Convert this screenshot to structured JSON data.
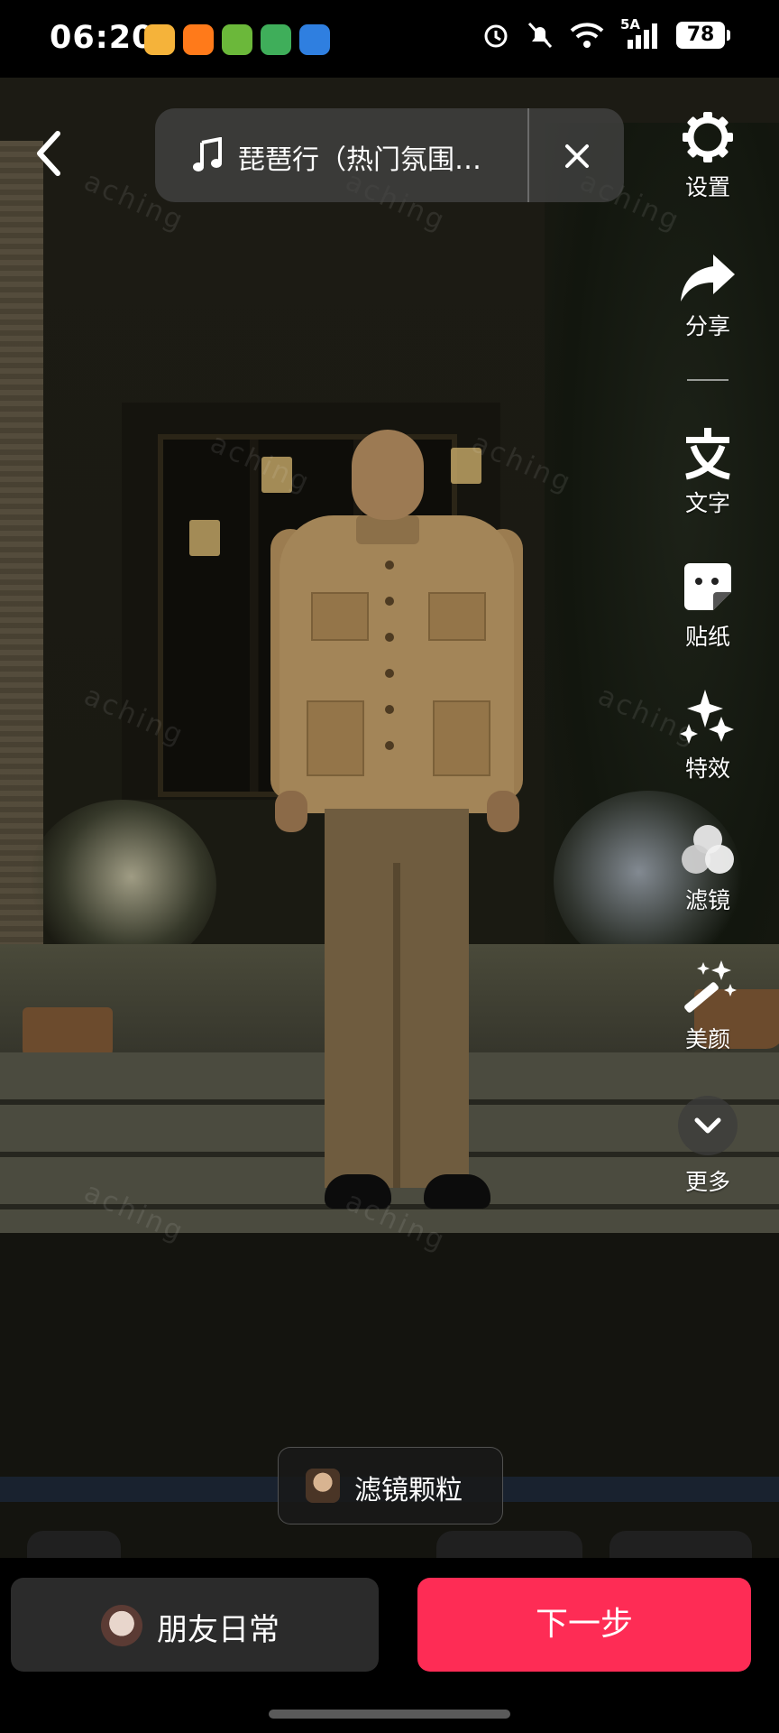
{
  "status_bar": {
    "time": "06:20",
    "network": "5A",
    "battery": "78"
  },
  "music": {
    "title": "琵琶行（热门氛围…"
  },
  "toolbar": {
    "settings": "设置",
    "share": "分享",
    "text": "文字",
    "sticker": "贴纸",
    "effects": "特效",
    "filter": "滤镜",
    "beauty": "美颜",
    "more": "更多"
  },
  "filter_chip": {
    "label": "滤镜颗粒"
  },
  "bottom": {
    "friends_label": "朋友日常",
    "next_label": "下一步"
  },
  "watermark": "aching",
  "colors": {
    "accent": "#fe2c55",
    "pill_bg": "#464646"
  }
}
